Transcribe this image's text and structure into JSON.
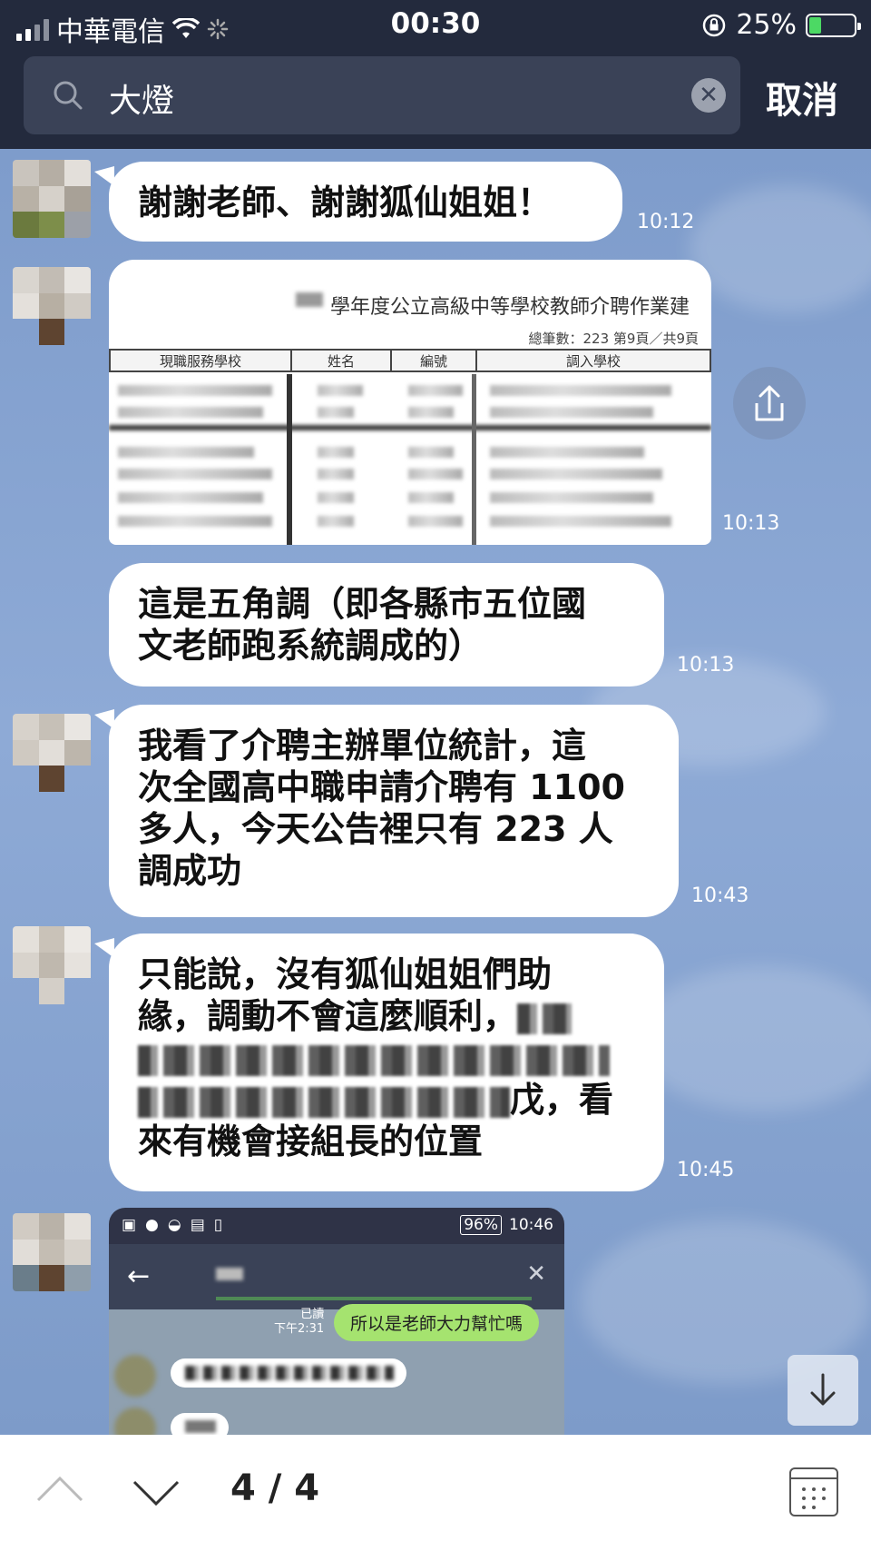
{
  "status_bar": {
    "carrier": "中華電信",
    "time": "00:30",
    "battery": "25%",
    "battery_level": 0.25
  },
  "search": {
    "query": "大燈",
    "cancel_label": "取消"
  },
  "messages": [
    {
      "text": "謝謝老師、謝謝狐仙姐姐！",
      "time": "10:12"
    },
    {
      "type": "image",
      "doc_title": "學年度公立高級中等學校教師介聘作業建",
      "doc_count": "總筆數：223  第9頁／共9頁",
      "columns": [
        "現職服務學校",
        "姓名",
        "編號",
        "調入學校"
      ],
      "time": "10:13"
    },
    {
      "text": "這是五角調（即各縣市五位國文老師跑系統調成的）",
      "lines": [
        "這是五角調（即各縣市五位國",
        "文老師跑系統調成的）"
      ],
      "time": "10:13"
    },
    {
      "text": "我看了介聘主辦單位統計，這次全國高中職申請介聘有 1100 多人，今天公告裡只有 223 人調成功",
      "lines": [
        "我看了介聘主辦單位統計，這",
        "次全國高中職申請介聘有 1100",
        "多人，今天公告裡只有 223 人",
        "調成功"
      ],
      "time": "10:43"
    },
    {
      "lines_visible": [
        "只能說，沒有狐仙姐姐們助",
        "緣，調動不會這麼順利，",
        "戊，看",
        "來有機會接組長的位置"
      ],
      "time": "10:45"
    },
    {
      "type": "screenshot",
      "inner_time": "10:46",
      "inner_battery": "96%",
      "inner_read": "已讀",
      "inner_read_time": "下午2:31",
      "inner_bubble": "所以是老師大力幫忙嗎"
    }
  ],
  "nav": {
    "page": "4 / 4"
  }
}
